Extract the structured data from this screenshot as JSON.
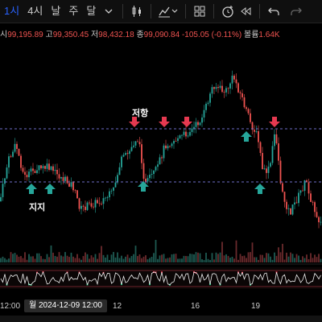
{
  "toolbar": {
    "interval_1": "1시",
    "interval_2": "4시",
    "interval_3": "날",
    "interval_4": "주",
    "interval_5": "달",
    "icons": [
      "chevron-down-icon",
      "candlestick-icon",
      "indicators-icon",
      "layout-grid-icon",
      "alert-clock-icon",
      "replay-icon",
      "undo-icon",
      "redo-icon"
    ]
  },
  "ohlc": {
    "open_label": "시",
    "open": "99,195.89",
    "high_label": "고",
    "high": "99,350.45",
    "low_label": "저",
    "low": "98,432.18",
    "close_label": "종",
    "close": "99,090.84",
    "change": "-105.05 (-0.11%)",
    "volume_label": "볼륨",
    "volume": "1.64K"
  },
  "annotations": {
    "resistance": "저항",
    "support": "지지"
  },
  "xaxis": {
    "left": "12:00",
    "cursor": "월  2024-12-09  12:00",
    "t12": "12",
    "t16": "16",
    "t19": "19"
  },
  "colors": {
    "up": "#26a69a",
    "down": "#ef5350",
    "arrow_up": "#26a69a",
    "arrow_down": "#e53950",
    "level_line": "#6e6ec8",
    "accent": "#2962ff"
  }
}
